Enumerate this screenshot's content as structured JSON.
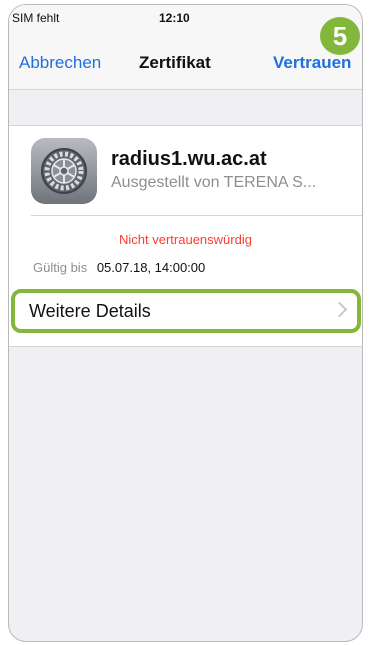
{
  "status_bar": {
    "carrier": "SIM fehlt",
    "time": "12:10"
  },
  "nav": {
    "cancel_label": "Abbrechen",
    "title": "Zertifikat",
    "trust_label": "Vertrauen"
  },
  "step_badge": "5",
  "certificate": {
    "icon": "settings-gear-icon",
    "name": "radius1.wu.ac.at",
    "issuer": "Ausgestellt von TERENA S...",
    "trust_status": "Nicht vertrauenswürdig",
    "valid_until_label": "Gültig bis",
    "valid_until_value": "05.07.18, 14:00:00"
  },
  "details": {
    "label": "Weitere Details"
  },
  "colors": {
    "link": "#1f6fde",
    "warning": "#ff3b30",
    "highlight": "#83b73b"
  }
}
